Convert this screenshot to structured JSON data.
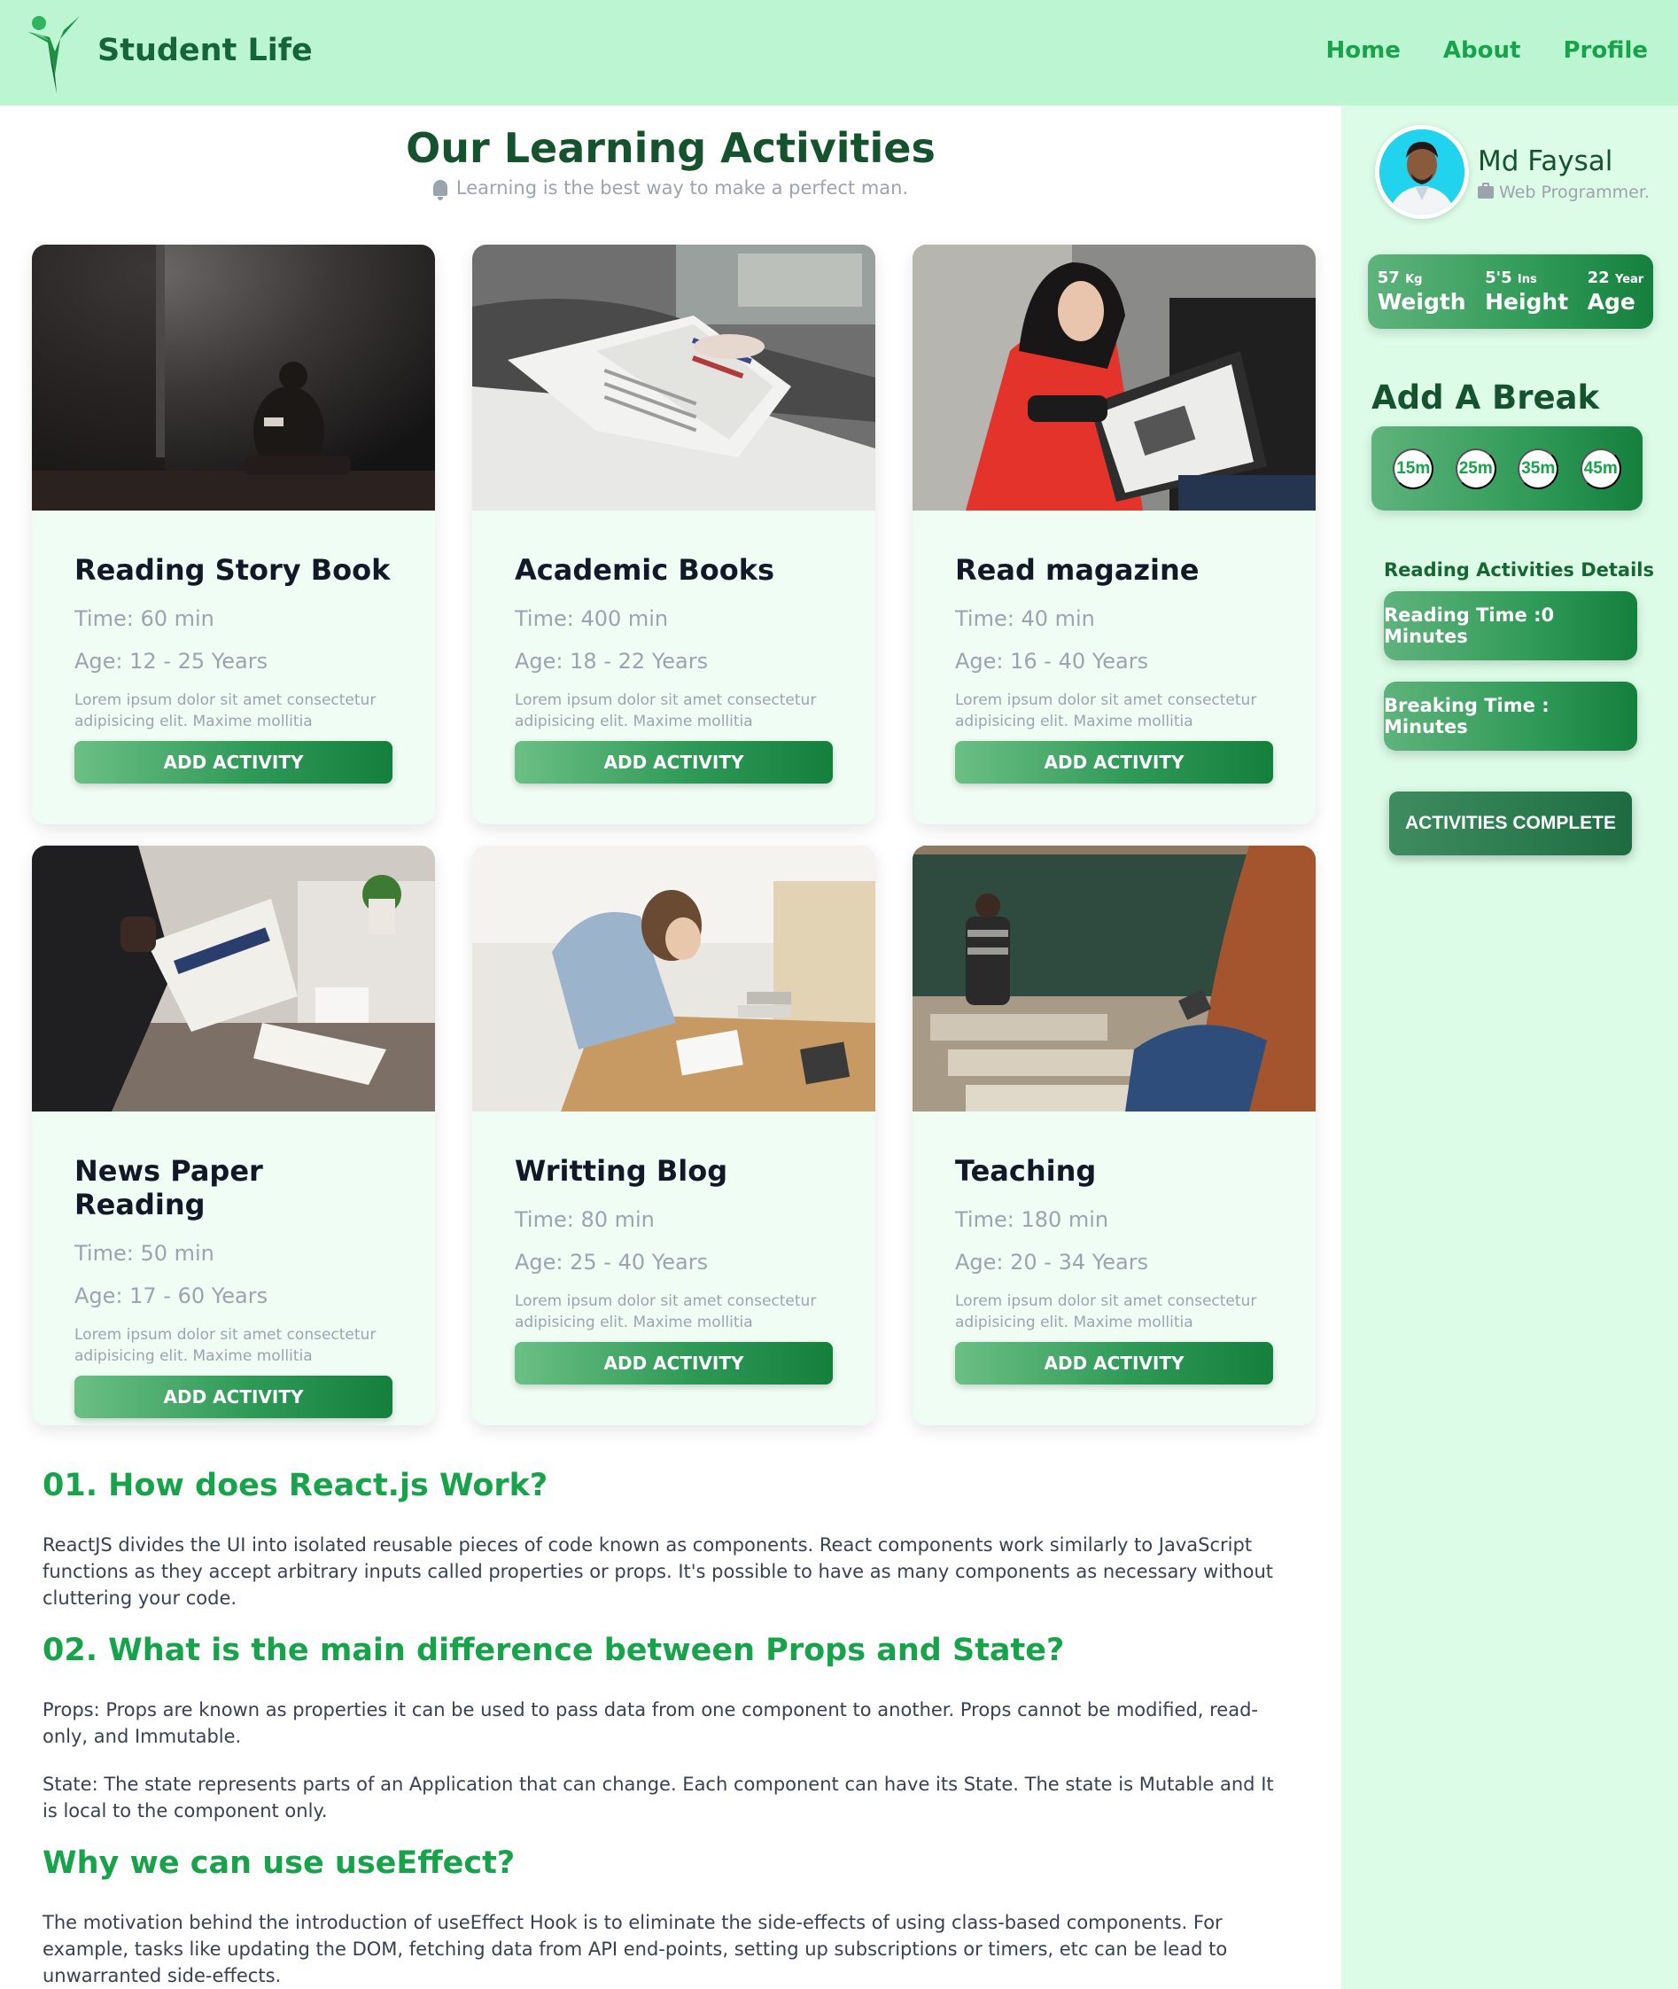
{
  "brand": {
    "name": "Student Life"
  },
  "nav": [
    {
      "label": "Home"
    },
    {
      "label": "About"
    },
    {
      "label": "Profile"
    }
  ],
  "main": {
    "title": "Our Learning Activities",
    "subtitle": "Learning is the best way to make a perfect man."
  },
  "cards": [
    {
      "title": "Reading Story Book",
      "time": "Time: 60 min",
      "age": "Age: 12 - 25 Years",
      "desc": "Lorem ipsum dolor sit amet consectetur adipisicing elit. Maxime mollitia",
      "button": "ADD ACTIVITY",
      "image": "person reading in dark room"
    },
    {
      "title": "Academic Books",
      "time": "Time: 400 min",
      "age": "Age: 18 - 22 Years",
      "desc": "Lorem ipsum dolor sit amet consectetur adipisicing elit. Maxime mollitia",
      "button": "ADD ACTIVITY",
      "image": "open magazine on lap"
    },
    {
      "title": "Read magazine",
      "time": "Time: 40 min",
      "age": "Age: 16 - 40 Years",
      "desc": "Lorem ipsum dolor sit amet consectetur adipisicing elit. Maxime mollitia",
      "button": "ADD ACTIVITY",
      "image": "woman in red sweater reading magazine"
    },
    {
      "title": "News Paper Reading",
      "time": "Time: 50 min",
      "age": "Age: 17 - 60 Years",
      "desc": "Lorem ipsum dolor sit amet consectetur adipisicing elit. Maxime mollitia",
      "button": "ADD ACTIVITY",
      "image": "man reading business newspaper"
    },
    {
      "title": "Writting Blog",
      "time": "Time: 80 min",
      "age": "Age: 25 - 40 Years",
      "desc": "Lorem ipsum dolor sit amet consectetur adipisicing elit. Maxime mollitia",
      "button": "ADD ACTIVITY",
      "image": "woman writing at desk"
    },
    {
      "title": "Teaching",
      "time": "Time: 180 min",
      "age": "Age: 20 - 34 Years",
      "desc": "Lorem ipsum dolor sit amet consectetur adipisicing elit. Maxime mollitia",
      "button": "ADD ACTIVITY",
      "image": "teacher writing on chalkboard"
    }
  ],
  "qa": [
    {
      "heading": "01. How does React.js Work?",
      "paragraphs": [
        "ReactJS divides the UI into isolated reusable pieces of code known as components. React components work similarly to JavaScript functions as they accept arbitrary inputs called properties or props. It's possible to have as many components as necessary without cluttering your code."
      ]
    },
    {
      "heading": "02. What is the main difference between Props and State?",
      "paragraphs": [
        "Props: Props are known as properties it can be used to pass data from one component to another. Props cannot be modified, read-only, and Immutable.",
        "State: The state represents parts of an Application that can change. Each component can have its State. The state is Mutable and It is local to the component only."
      ]
    },
    {
      "heading": "Why we can use useEffect?",
      "paragraphs": [
        "The motivation behind the introduction of useEffect Hook is to eliminate the side-effects of using class-based components. For example, tasks like updating the DOM, fetching data from API end-points, setting up subscriptions or timers, etc can be lead to unwarranted side-effects."
      ]
    }
  ],
  "sidebar": {
    "profile": {
      "name": "Md Faysal",
      "role": "Web Programmer."
    },
    "stats": [
      {
        "value": "57",
        "unit": "Kg",
        "label": "Weigth"
      },
      {
        "value": "5'5",
        "unit": "Ins",
        "label": "Height"
      },
      {
        "value": "22",
        "unit": "Year",
        "label": "Age"
      }
    ],
    "break_title": "Add A Break",
    "breaks": [
      "15m",
      "25m",
      "35m",
      "45m"
    ],
    "details_title": "Reading Activities Details",
    "reading_time": "Reading Time :0 Minutes",
    "breaking_time": "Breaking Time : Minutes",
    "complete_button": "ACTIVITIES COMPLETE"
  },
  "colors": {
    "header_bg": "#bbf5d2",
    "sidebar_bg": "#dcfce7",
    "accent": "#16a34a",
    "dark_green": "#14532d"
  }
}
